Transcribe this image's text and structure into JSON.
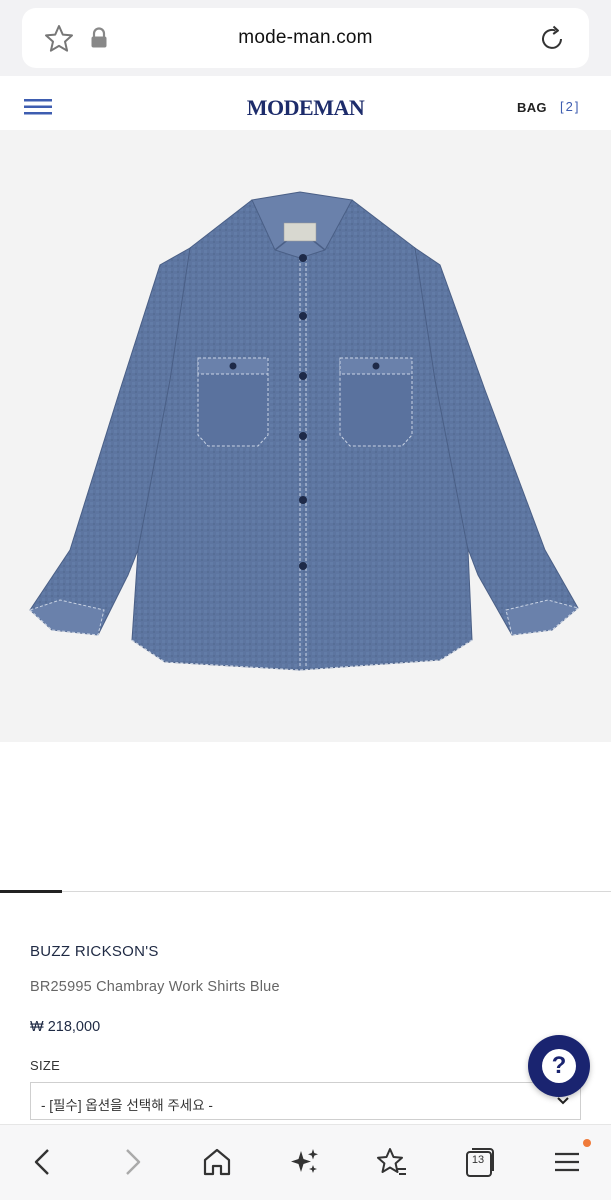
{
  "browser": {
    "url": "mode-man.com",
    "tab_count": "13",
    "icons": [
      "star-icon",
      "lock-icon",
      "reload-icon",
      "back-icon",
      "forward-icon",
      "home-icon",
      "sparkle-icon",
      "bookmark-star-icon",
      "tabs-icon",
      "menu-icon"
    ]
  },
  "header": {
    "logo": "MODEMAN",
    "bag_label": "BAG",
    "bag_count": "[2]"
  },
  "product": {
    "image_alt": "Chambray work shirt, blue, long sleeves with two chest pockets",
    "brand": "BUZZ RICKSON'S",
    "name": "BR25995 Chambray Work Shirts Blue",
    "price": "₩ 218,000",
    "size_label": "SIZE",
    "size_placeholder": "- [필수] 옵션을 선택해 주세요 -"
  },
  "help": {
    "glyph": "?"
  },
  "colors": {
    "brand_navy": "#1d2c6b",
    "accent_blue": "#3e5db0",
    "help_button": "#1a2470",
    "notification_dot": "#f07b3a",
    "shirt_blue": "#5d75a0"
  }
}
